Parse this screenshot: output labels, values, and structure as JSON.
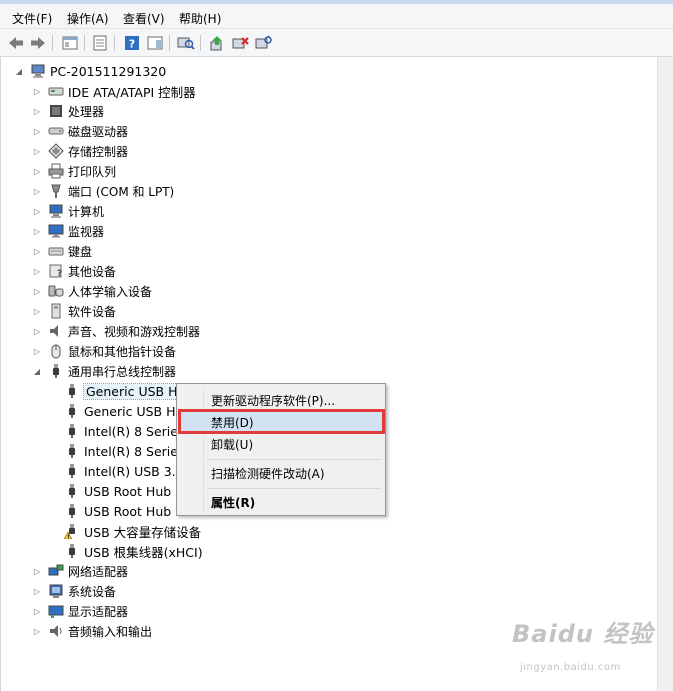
{
  "menu": {
    "file": "文件(F)",
    "action": "操作(A)",
    "view": "查看(V)",
    "help": "帮助(H)"
  },
  "toolbar": {
    "icons": [
      "back-icon",
      "forward-icon",
      "show-hide-console-tree-icon",
      "properties-icon",
      "help-icon",
      "action-pane-icon",
      "scan-hardware-icon",
      "update-driver-icon",
      "disable-device-icon",
      "uninstall-device-icon"
    ]
  },
  "tree": {
    "root": "PC-201511291320",
    "categories_top": [
      {
        "label": "IDE ATA/ATAPI 控制器",
        "icon": "ide-controller-icon"
      },
      {
        "label": "处理器",
        "icon": "processor-icon"
      },
      {
        "label": "磁盘驱动器",
        "icon": "disk-drive-icon"
      },
      {
        "label": "存储控制器",
        "icon": "storage-controller-icon"
      },
      {
        "label": "打印队列",
        "icon": "printer-icon"
      },
      {
        "label": "端口 (COM 和 LPT)",
        "icon": "port-icon"
      },
      {
        "label": "计算机",
        "icon": "computer-icon"
      },
      {
        "label": "监视器",
        "icon": "monitor-icon"
      },
      {
        "label": "键盘",
        "icon": "keyboard-icon"
      },
      {
        "label": "其他设备",
        "icon": "other-devices-icon"
      },
      {
        "label": "人体学输入设备",
        "icon": "hid-icon"
      },
      {
        "label": "软件设备",
        "icon": "software-device-icon"
      },
      {
        "label": "声音、视频和游戏控制器",
        "icon": "sound-icon"
      },
      {
        "label": "鼠标和其他指针设备",
        "icon": "mouse-icon"
      },
      {
        "label": "通用串行总线控制器",
        "icon": "usb-icon"
      }
    ],
    "usb_children": [
      {
        "label": "Generic USB Hub",
        "icon": "usb-plug-icon"
      },
      {
        "label": "Generic USB Hub",
        "icon": "usb-plug-icon"
      },
      {
        "label": "Intel(R) 8 Series",
        "icon": "usb-plug-icon"
      },
      {
        "label": "Intel(R) 8 Series",
        "icon": "usb-plug-icon"
      },
      {
        "label": "Intel(R) USB 3.0",
        "icon": "usb-plug-icon"
      },
      {
        "label": "USB Root Hub",
        "icon": "usb-plug-icon"
      },
      {
        "label": "USB Root Hub",
        "icon": "usb-plug-icon"
      },
      {
        "label": "USB 大容量存储设备",
        "icon": "usb-warning-icon"
      },
      {
        "label": "USB 根集线器(xHCI)",
        "icon": "usb-plug-icon"
      }
    ],
    "categories_bottom": [
      {
        "label": "网络适配器",
        "icon": "network-icon"
      },
      {
        "label": "系统设备",
        "icon": "system-devices-icon"
      },
      {
        "label": "显示适配器",
        "icon": "display-adapter-icon"
      },
      {
        "label": "音频输入和输出",
        "icon": "audio-io-icon"
      }
    ]
  },
  "context_menu": {
    "update_driver": "更新驱动程序软件(P)...",
    "disable": "禁用(D)",
    "uninstall": "卸载(U)",
    "scan": "扫描检测硬件改动(A)",
    "properties": "属性(R)"
  },
  "watermark": {
    "main": "Baidu 经验",
    "sub": "jingyan.baidu.com"
  },
  "colors": {
    "highlight_border": "#e03a3a",
    "menu_hover": "#d1e2f2"
  }
}
